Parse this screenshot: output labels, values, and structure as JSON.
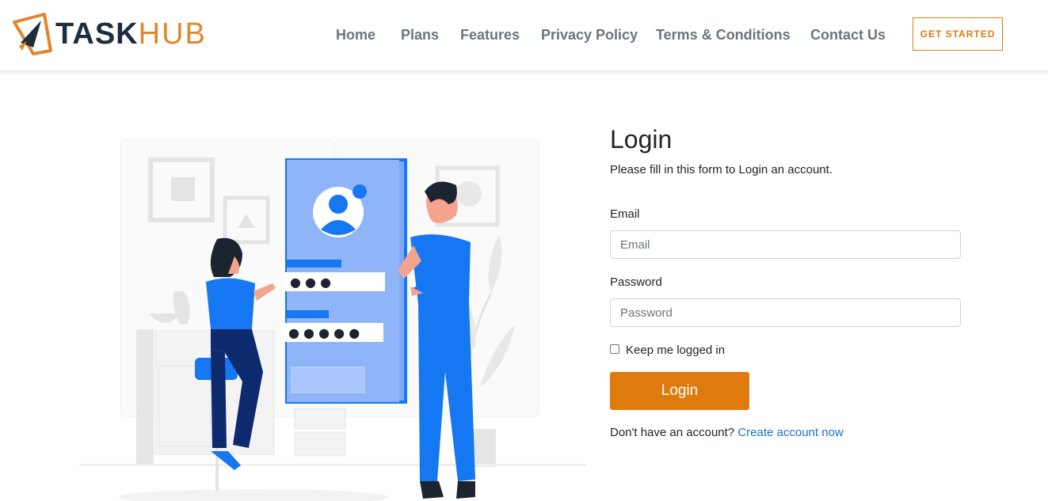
{
  "brand": {
    "part1": "TASK",
    "part2": "HUB"
  },
  "nav": {
    "items": [
      {
        "label": "Home"
      },
      {
        "label": "Plans"
      },
      {
        "label": "Features"
      },
      {
        "label": "Privacy Policy"
      },
      {
        "label": "Terms & Conditions"
      },
      {
        "label": "Contact Us"
      }
    ],
    "cta": "GET STARTED"
  },
  "login": {
    "title": "Login",
    "subtitle": "Please fill in this form to Login an account.",
    "email_label": "Email",
    "email_placeholder": "Email",
    "email_value": "",
    "password_label": "Password",
    "password_placeholder": "Password",
    "password_value": "",
    "remember_label": "Keep me logged in",
    "remember_checked": false,
    "submit": "Login",
    "signup_prompt": "Don't have an account?",
    "signup_link": "Create account now"
  },
  "illustration": {
    "password_mask_1": "● ● ●",
    "password_mask_2": "● ● ● ● ●"
  },
  "colors": {
    "accent": "#df7a0e",
    "brand_dark": "#1c2d3d",
    "brand_orange": "#e0862d",
    "illustration_blue": "#1677f2",
    "link_blue": "#1a73c9"
  }
}
